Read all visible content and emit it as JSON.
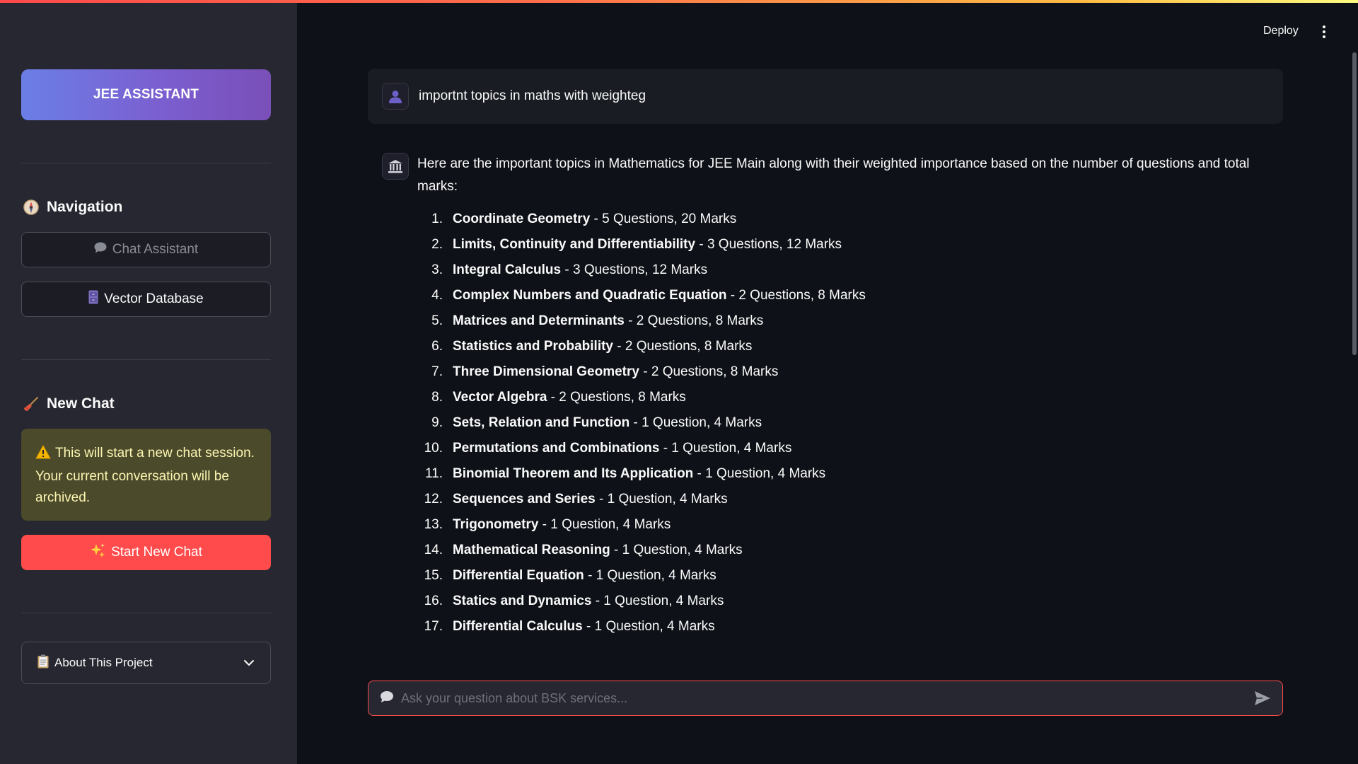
{
  "sidebar": {
    "brand_label": "JEE ASSISTANT",
    "navigation_title": "Navigation",
    "nav_items": [
      {
        "label": "Chat Assistant",
        "icon": "speech-bubble-icon"
      },
      {
        "label": "Vector Database",
        "icon": "file-cabinet-icon"
      }
    ],
    "new_chat_title": "New Chat",
    "warning_text": "This will start a new chat session. Your current conversation will be archived.",
    "start_button_label": "Start New Chat",
    "about_label": "About This Project"
  },
  "header": {
    "deploy_label": "Deploy"
  },
  "chat": {
    "user_message": "importnt topics in maths with weighteg",
    "assistant_intro": "Here are the important topics in Mathematics for JEE Main along with their weighted importance based on the number of questions and total marks:",
    "topics": [
      {
        "num": "1.",
        "name": "Coordinate Geometry",
        "detail": " - 5 Questions, 20 Marks"
      },
      {
        "num": "2.",
        "name": "Limits, Continuity and Differentiability",
        "detail": " - 3 Questions, 12 Marks"
      },
      {
        "num": "3.",
        "name": "Integral Calculus",
        "detail": " - 3 Questions, 12 Marks"
      },
      {
        "num": "4.",
        "name": "Complex Numbers and Quadratic Equation",
        "detail": " - 2 Questions, 8 Marks"
      },
      {
        "num": "5.",
        "name": "Matrices and Determinants",
        "detail": " - 2 Questions, 8 Marks"
      },
      {
        "num": "6.",
        "name": "Statistics and Probability",
        "detail": " - 2 Questions, 8 Marks"
      },
      {
        "num": "7.",
        "name": "Three Dimensional Geometry",
        "detail": " - 2 Questions, 8 Marks"
      },
      {
        "num": "8.",
        "name": "Vector Algebra",
        "detail": " - 2 Questions, 8 Marks"
      },
      {
        "num": "9.",
        "name": "Sets, Relation and Function",
        "detail": " - 1 Question, 4 Marks"
      },
      {
        "num": "10.",
        "name": "Permutations and Combinations",
        "detail": " - 1 Question, 4 Marks"
      },
      {
        "num": "11.",
        "name": "Binomial Theorem and Its Application",
        "detail": " - 1 Question, 4 Marks"
      },
      {
        "num": "12.",
        "name": "Sequences and Series",
        "detail": " - 1 Question, 4 Marks"
      },
      {
        "num": "13.",
        "name": "Trigonometry",
        "detail": " - 1 Question, 4 Marks"
      },
      {
        "num": "14.",
        "name": "Mathematical Reasoning",
        "detail": " - 1 Question, 4 Marks"
      },
      {
        "num": "15.",
        "name": "Differential Equation",
        "detail": " - 1 Question, 4 Marks"
      },
      {
        "num": "16.",
        "name": "Statics and Dynamics",
        "detail": " - 1 Question, 4 Marks"
      },
      {
        "num": "17.",
        "name": "Differential Calculus",
        "detail": " - 1 Question, 4 Marks"
      }
    ],
    "input_placeholder": "Ask your question about BSK services..."
  },
  "colors": {
    "accent": "#ff4b4b",
    "brand_gradient_start": "#6b7fe6",
    "brand_gradient_end": "#7a4fb8",
    "warning_bg": "#4b4a2b",
    "warning_text": "#fdf6b2"
  }
}
